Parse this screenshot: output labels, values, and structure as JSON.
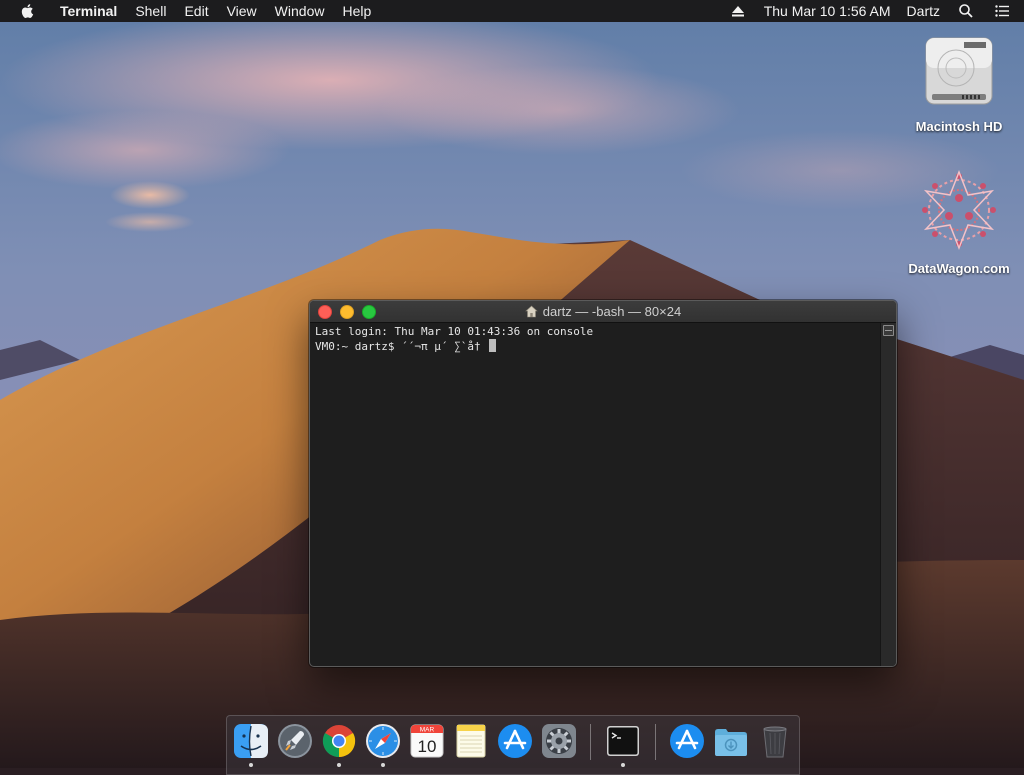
{
  "menubar": {
    "app_name": "Terminal",
    "menus": [
      "Shell",
      "Edit",
      "View",
      "Window",
      "Help"
    ],
    "clock": "Thu Mar 10  1:56 AM",
    "user": "Dartz"
  },
  "desktop_icons": [
    {
      "label": "Macintosh HD",
      "icon": "hard-drive-icon"
    },
    {
      "label": "DataWagon.com",
      "icon": "datawagon-logo-icon"
    }
  ],
  "terminal": {
    "title": "dartz — -bash — 80×24",
    "lines": [
      "Last login: Thu Mar 10 01:43:36 on console",
      "VM0:~ dartz$ ´´¬π µ´ ∑`å† "
    ]
  },
  "calendar_icon": {
    "month": "MAR",
    "day": "10"
  },
  "dock": {
    "items": [
      {
        "name": "finder-icon",
        "running": true
      },
      {
        "name": "launchpad-icon",
        "running": false
      },
      {
        "name": "chrome-icon",
        "running": true
      },
      {
        "name": "safari-icon",
        "running": true
      },
      {
        "name": "calendar-icon",
        "running": false
      },
      {
        "name": "notes-icon",
        "running": false
      },
      {
        "name": "app-store-icon",
        "running": false
      },
      {
        "name": "system-preferences-icon",
        "running": false
      },
      {
        "name": "terminal-icon",
        "running": true
      },
      {
        "name": "applications-folder-icon",
        "running": false
      },
      {
        "name": "downloads-folder-icon",
        "running": false
      },
      {
        "name": "trash-icon",
        "running": false
      }
    ]
  }
}
